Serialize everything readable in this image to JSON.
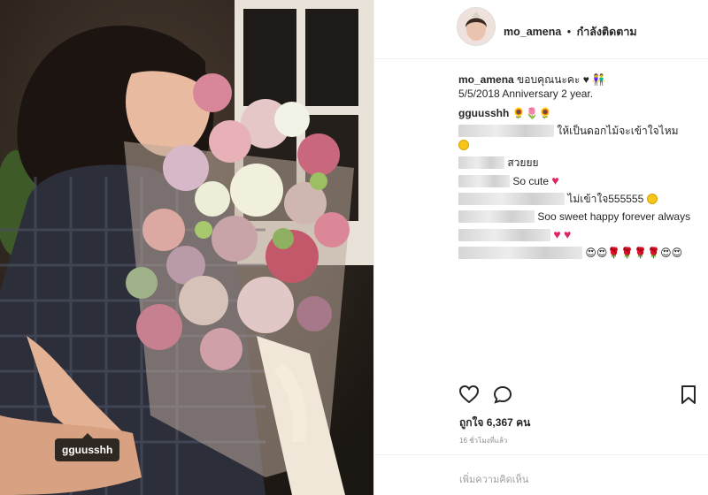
{
  "post": {
    "tag_label": "gguusshh",
    "header": {
      "username": "mo_amena",
      "separator": "•",
      "follow_status": "กำลังติดตาม"
    },
    "caption": {
      "username": "mo_amena",
      "text": "ขอบคุณนะคะ ♥",
      "line2": "5/5/2018 Anniversary 2 year."
    },
    "comments": [
      {
        "username": "gguusshh",
        "text": ""
      },
      {
        "username": "",
        "text": "ให้เป็นดอกไม้จะเข้าใจไหม"
      },
      {
        "username": "",
        "text": "สวยยย"
      },
      {
        "username": "",
        "text": "So cute"
      },
      {
        "username": "",
        "text": "ไม่เข้าใจ555555"
      },
      {
        "username": "",
        "text": "Soo sweet happy forever always"
      },
      {
        "username": "",
        "text": ""
      },
      {
        "username": "",
        "text": ""
      }
    ],
    "likes": "ถูกใจ 6,367 คน",
    "time_ago": "16 ชั่วโมงที่แล้ว",
    "add_comment_placeholder": "เพิ่มความคิดเห็น",
    "icons": {
      "like": "heart-outline-icon",
      "comment": "speech-bubble-icon",
      "save": "bookmark-icon"
    },
    "colors": {
      "heart": "#e0245e",
      "muted_text": "#8e8e8e",
      "border": "#efefef"
    }
  }
}
